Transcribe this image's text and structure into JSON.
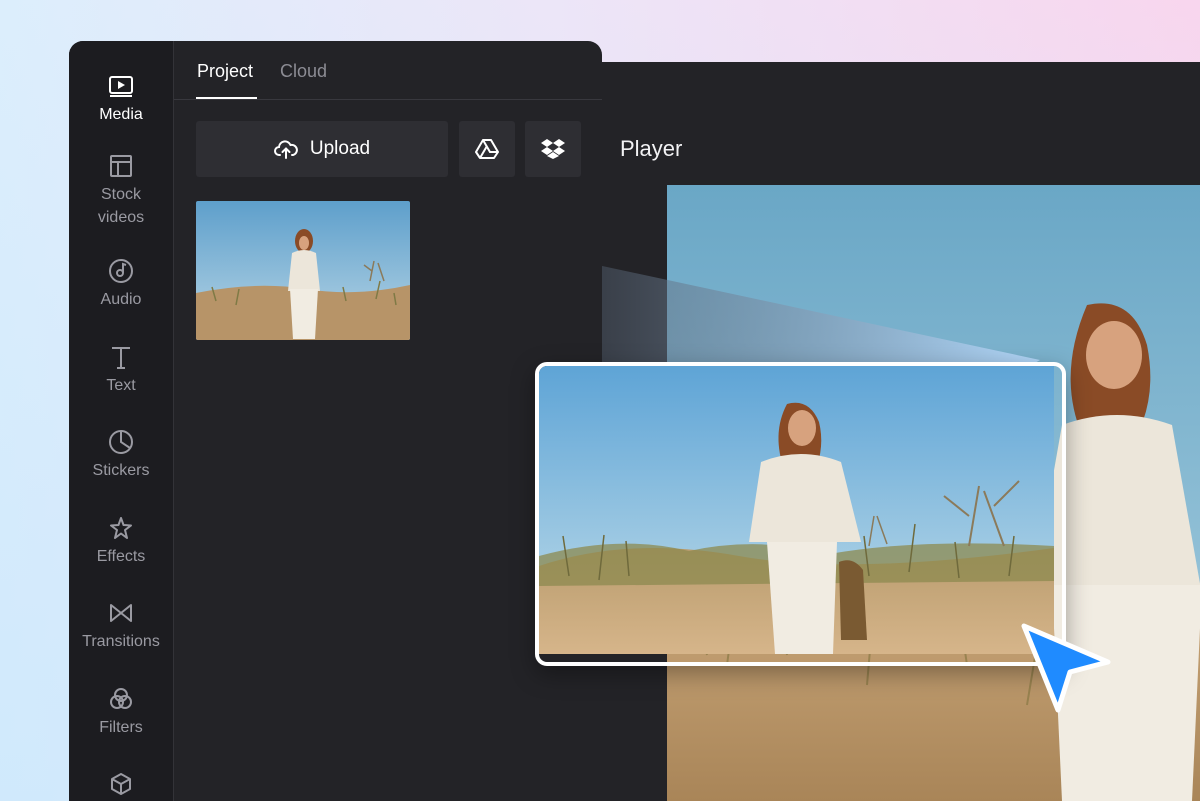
{
  "sidebar": {
    "items": [
      {
        "label": "Media",
        "icon": "play-box-icon",
        "active": true
      },
      {
        "label": "Stock\nvideos",
        "icon": "layout-icon",
        "active": false
      },
      {
        "label": "Audio",
        "icon": "music-disc-icon",
        "active": false
      },
      {
        "label": "Text",
        "icon": "text-t-icon",
        "active": false
      },
      {
        "label": "Stickers",
        "icon": "sticker-icon",
        "active": false
      },
      {
        "label": "Effects",
        "icon": "sparkle-star-icon",
        "active": false
      },
      {
        "label": "Transitions",
        "icon": "bowtie-icon",
        "active": false
      },
      {
        "label": "Filters",
        "icon": "overlapping-circles-icon",
        "active": false
      },
      {
        "label": "",
        "icon": "cube-icon",
        "active": false
      }
    ]
  },
  "tabs": [
    {
      "label": "Project",
      "active": true
    },
    {
      "label": "Cloud",
      "active": false
    }
  ],
  "media": {
    "upload_label": "Upload",
    "upload_icon": "cloud-upload-icon",
    "google_drive_icon": "google-drive-icon",
    "dropbox_icon": "dropbox-icon"
  },
  "player": {
    "title": "Player"
  },
  "colors": {
    "panel": "#232327",
    "sidebar": "#1c1c20",
    "button": "#2e2e33",
    "cursor": "#1f8bff"
  }
}
